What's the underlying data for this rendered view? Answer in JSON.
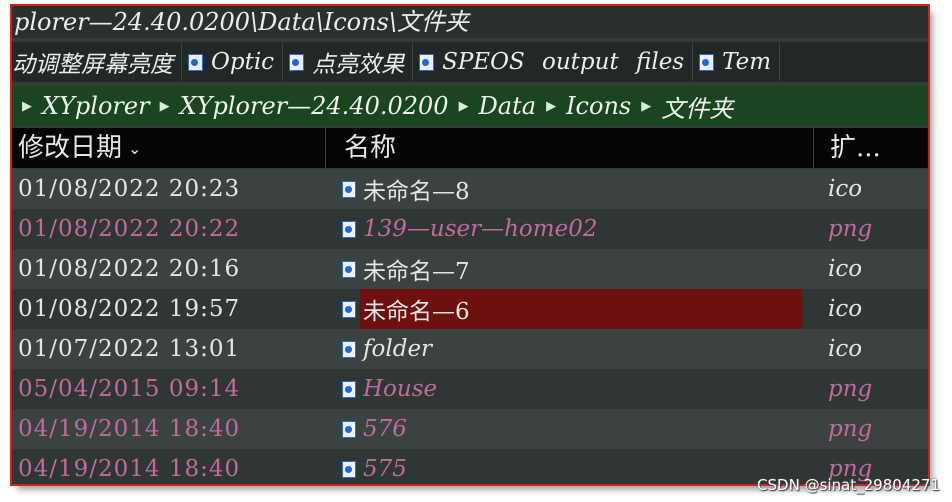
{
  "window": {
    "title": "plorer—24.40.0200\\Data\\Icons\\文件夹"
  },
  "tabs": [
    {
      "label": "动调整屏幕亮度",
      "icon": null
    },
    {
      "label": "Optic",
      "icon": "file-icon"
    },
    {
      "label": "点亮效果",
      "icon": "file-icon"
    },
    {
      "label": "SPEOS output files",
      "icon": "file-icon"
    },
    {
      "label": "Tem",
      "icon": "file-icon"
    }
  ],
  "breadcrumb": [
    "XYplorer",
    "XYplorer—24.40.0200",
    "Data",
    "Icons",
    "文件夹"
  ],
  "columns": {
    "date": "修改日期",
    "name": "名称",
    "ext": "扩..."
  },
  "files": [
    {
      "date": "01/08/2022 20:23",
      "name": "未命名—8",
      "ext": "ico",
      "style": "normal"
    },
    {
      "date": "01/08/2022 20:22",
      "name": "139—user—home02",
      "ext": "png",
      "style": "pink"
    },
    {
      "date": "01/08/2022 20:16",
      "name": "未命名—7",
      "ext": "ico",
      "style": "normal"
    },
    {
      "date": "01/08/2022 19:57",
      "name": "未命名—6",
      "ext": "ico",
      "style": "normal",
      "selected": true
    },
    {
      "date": "01/07/2022 13:01",
      "name": "folder",
      "ext": "ico",
      "style": "normal"
    },
    {
      "date": "05/04/2015 09:14",
      "name": "House",
      "ext": "png",
      "style": "pink"
    },
    {
      "date": "04/19/2014 18:40",
      "name": "576",
      "ext": "png",
      "style": "pink"
    },
    {
      "date": "04/19/2014 18:40",
      "name": "575",
      "ext": "png",
      "style": "pink"
    }
  ],
  "watermark": "CSDN @sinat_29804271",
  "colors": {
    "frame_border": "#d21f1f",
    "breadcrumb_bg": "#19461f",
    "selection": "#6f1010",
    "png_text": "#c26a9c"
  }
}
